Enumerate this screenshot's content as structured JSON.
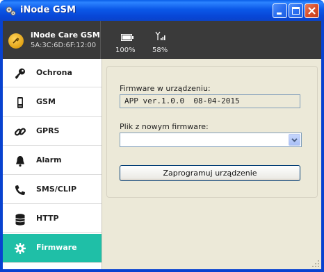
{
  "window": {
    "title": "iNode GSM",
    "icon": "gears-icon",
    "controls": [
      "minimize-icon",
      "maximize-icon",
      "close-icon"
    ]
  },
  "device": {
    "name": "iNode Care GSM",
    "mac": "5A:3C:6D:6F:12:00",
    "icon": "device-coin-icon"
  },
  "status": {
    "battery_text": "100%",
    "battery": 1.0,
    "signal_text": "58%",
    "signal": 0.58
  },
  "nav": {
    "items": [
      {
        "label": "Ochrona",
        "icon": "key-icon",
        "active": false
      },
      {
        "label": "GSM",
        "icon": "phone-icon",
        "active": false
      },
      {
        "label": "GPRS",
        "icon": "link-icon",
        "active": false
      },
      {
        "label": "Alarm",
        "icon": "bell-icon",
        "active": false
      },
      {
        "label": "SMS/CLIP",
        "icon": "handset-icon",
        "active": false
      },
      {
        "label": "HTTP",
        "icon": "database-icon",
        "active": false
      },
      {
        "label": "Firmware",
        "icon": "gear-icon",
        "active": true
      }
    ]
  },
  "firmware": {
    "current_label": "Firmware w urządzeniu:",
    "current_value": "APP ver.1.0.0  08-04-2015",
    "file_label": "Plik z nowym firmware:",
    "file_value": "",
    "program_button": "Zaprogramuj urządzenie"
  },
  "colors": {
    "accent": "#1fbfa7",
    "header_bg": "#3a3a3a",
    "titlebar": "#0b58e8"
  }
}
